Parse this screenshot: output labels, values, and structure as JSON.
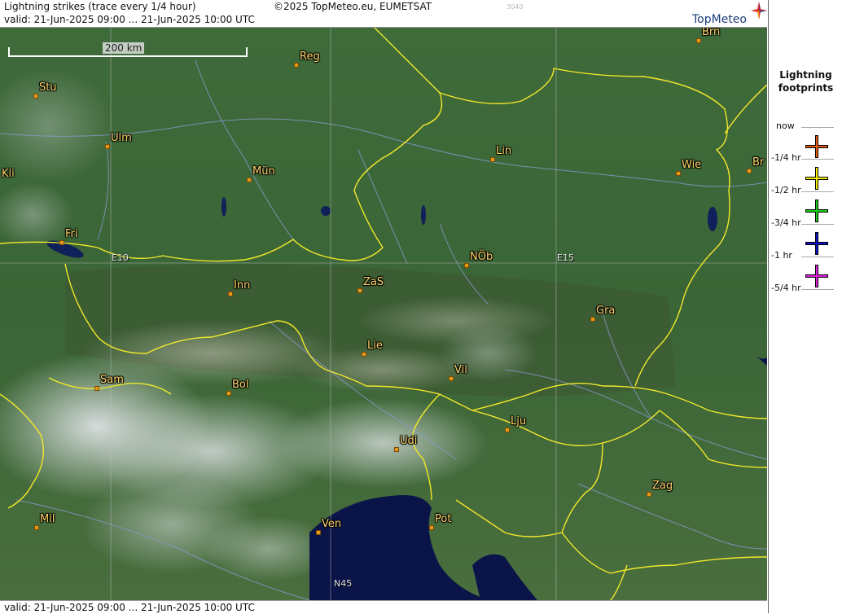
{
  "header": {
    "line1": "Lightning strikes (trace every 1/4 hour)",
    "line2": "valid:  21-Jun-2025 09:00 ... 21-Jun-2025 10:00 UTC",
    "copyright": "©2025 TopMeteo.eu, EUMETSAT",
    "code": "3040",
    "logo": "TopMeteo"
  },
  "footer": {
    "valid": "valid:  21-Jun-2025 09:00 ... 21-Jun-2025 10:00 UTC"
  },
  "map": {
    "scale": "200 km",
    "grid_labels": {
      "e10": "E10",
      "e15": "E15",
      "n45": "N45"
    },
    "cities": [
      {
        "id": "brn",
        "name": "Brn"
      },
      {
        "id": "reg",
        "name": "Reg"
      },
      {
        "id": "stu",
        "name": "Stu"
      },
      {
        "id": "ulm",
        "name": "Ulm"
      },
      {
        "id": "lin",
        "name": "Lin"
      },
      {
        "id": "kli",
        "name": "Kli"
      },
      {
        "id": "mun",
        "name": "Mün"
      },
      {
        "id": "wie",
        "name": "Wie"
      },
      {
        "id": "bra",
        "name": "Br"
      },
      {
        "id": "fri",
        "name": "Fri"
      },
      {
        "id": "nob",
        "name": "NÖb"
      },
      {
        "id": "inn",
        "name": "Inn"
      },
      {
        "id": "zas",
        "name": "ZaS"
      },
      {
        "id": "gra",
        "name": "Gra"
      },
      {
        "id": "lie",
        "name": "Lie"
      },
      {
        "id": "vil",
        "name": "Vil"
      },
      {
        "id": "sam",
        "name": "Sam"
      },
      {
        "id": "bol",
        "name": "Bol"
      },
      {
        "id": "lju",
        "name": "Lju"
      },
      {
        "id": "udi",
        "name": "Udi"
      },
      {
        "id": "zag",
        "name": "Zag"
      },
      {
        "id": "mil",
        "name": "Mil"
      },
      {
        "id": "ven",
        "name": "Ven"
      },
      {
        "id": "pot",
        "name": "Pot"
      }
    ]
  },
  "legend": {
    "title_line1": "Lightning",
    "title_line2": "footprints",
    "items": [
      {
        "label": "now",
        "color": "#e85a10"
      },
      {
        "label": "-1/4 hr",
        "color": "#f5f000"
      },
      {
        "label": "-1/2 hr",
        "color": "#18d018"
      },
      {
        "label": "-3/4 hr",
        "color": "#0a10c8"
      },
      {
        "label": "-1 hr",
        "color": "#e020e0"
      },
      {
        "label": "-5/4 hr",
        "color": ""
      }
    ]
  }
}
